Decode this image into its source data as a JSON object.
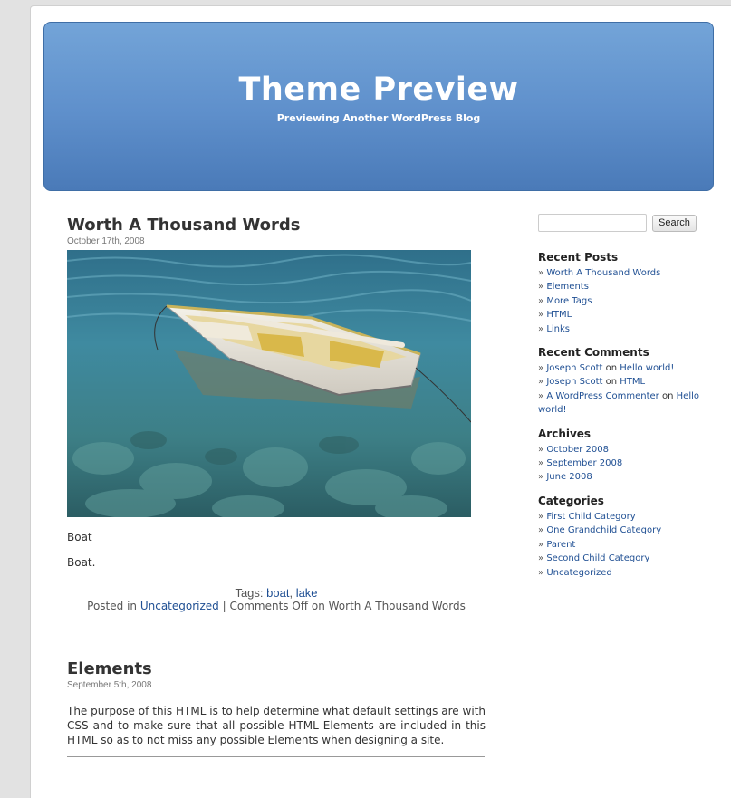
{
  "blog": {
    "title": "Theme Preview",
    "description": "Previewing Another WordPress Blog"
  },
  "posts": [
    {
      "title": "Worth A Thousand Words",
      "date": "October 17th, 2008",
      "image": "boat-photo",
      "caption": "Boat",
      "body": "Boat.",
      "tags_label": "Tags:",
      "tags": [
        "boat",
        "lake"
      ],
      "posted_in_label": "Posted in",
      "category": "Uncategorized",
      "comments": "Comments Off on Worth A Thousand Words"
    },
    {
      "title": "Elements",
      "date": "September 5th, 2008",
      "excerpt": "The purpose of this HTML is to help determine what default settings are with CSS and to make sure that all possible HTML Elements are included in this HTML so as to not miss any possible Elements when designing a site."
    }
  ],
  "sidebar": {
    "search": {
      "placeholder": "",
      "button_label": "Search"
    },
    "recent_posts": {
      "heading": "Recent Posts",
      "items": [
        "Worth A Thousand Words",
        "Elements",
        "More Tags",
        "HTML",
        "Links"
      ]
    },
    "recent_comments": {
      "heading": "Recent Comments",
      "items": [
        {
          "author": "Joseph Scott",
          "on": "on",
          "post": "Hello world!"
        },
        {
          "author": "Joseph Scott",
          "on": "on",
          "post": "HTML"
        },
        {
          "author": "A WordPress Commenter",
          "on": "on",
          "post": "Hello world!"
        }
      ]
    },
    "archives": {
      "heading": "Archives",
      "items": [
        "October 2008",
        "September 2008",
        "June 2008"
      ]
    },
    "categories": {
      "heading": "Categories",
      "items": [
        "First Child Category",
        "One Grandchild Category",
        "Parent",
        "Second Child Category",
        "Uncategorized"
      ]
    },
    "bullet": "»"
  }
}
